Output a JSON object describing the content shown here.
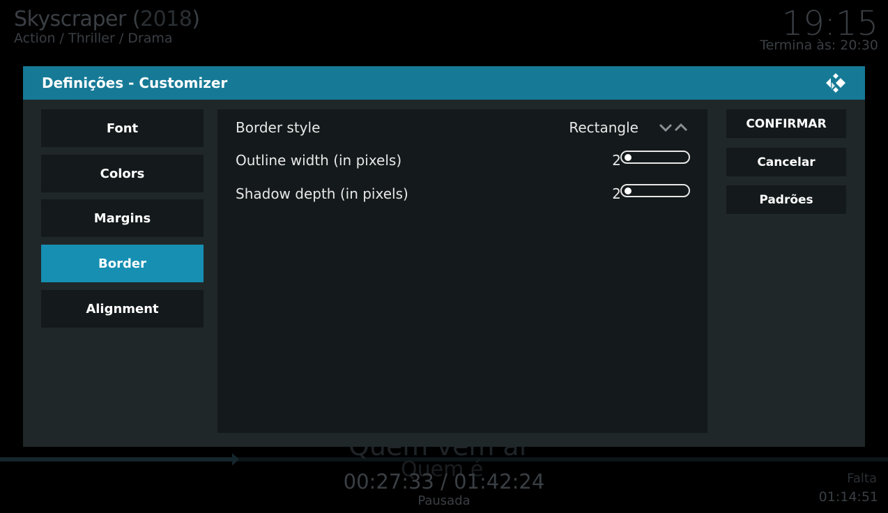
{
  "background": {
    "title": "Skyscraper (",
    "year": "2018",
    "title_close": ")",
    "genre": "Action / Thriller / Drama",
    "clock": "19:15",
    "ends_at": "Termina às: 20:30",
    "subtitle_line1": "Quem vem aí",
    "subtitle_line2": "Quem é",
    "time": "00:27:33 / 01:42:24",
    "status": "Pausada",
    "remaining_label": "Falta",
    "remaining": "01:14:51"
  },
  "dialog": {
    "title": "Definições - Customizer",
    "logo_icon": "kodi-logo-icon"
  },
  "categories": [
    {
      "label": "Font",
      "active": false
    },
    {
      "label": "Colors",
      "active": false
    },
    {
      "label": "Margins",
      "active": false
    },
    {
      "label": "Border",
      "active": true
    },
    {
      "label": "Alignment",
      "active": false
    }
  ],
  "settings": [
    {
      "label": "Border style",
      "value": "Rectangle",
      "control": "spinner"
    },
    {
      "label": "Outline width (in pixels)",
      "value": "2",
      "control": "slider",
      "level": 0
    },
    {
      "label": "Shadow depth (in pixels)",
      "value": "2",
      "control": "slider",
      "level": 0
    }
  ],
  "actions": {
    "confirm": "CONFIRMAR",
    "cancel": "Cancelar",
    "defaults": "Padrões"
  },
  "colors": {
    "header": "#167a96",
    "active_item": "#168fb2",
    "panel": "#14191b",
    "dialog_bg": "#202729"
  }
}
